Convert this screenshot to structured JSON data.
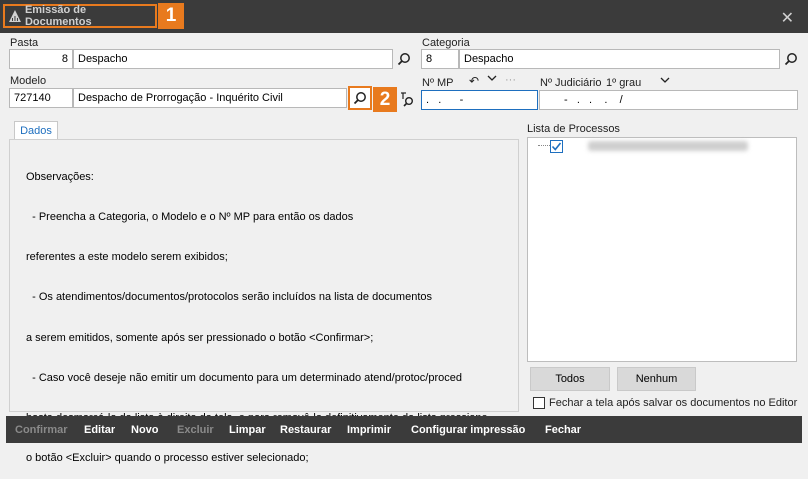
{
  "window": {
    "title": "Emissão de Documentos",
    "badge1": "1",
    "badge2": "2",
    "close_symbol": "✕"
  },
  "pasta": {
    "label": "Pasta",
    "code": "8",
    "name": "Despacho"
  },
  "categoria": {
    "label": "Categoria",
    "code": "8",
    "name": "Despacho"
  },
  "modelo": {
    "label": "Modelo",
    "code": "727140",
    "name": "Despacho de Prorrogação - Inquérito Civil"
  },
  "nmp": {
    "label": "Nº MP",
    "value": ".   .      -"
  },
  "judiciario": {
    "label": "Nº Judiciário",
    "grau": "1º grau",
    "value": "-   .   .    .    /"
  },
  "tabs": {
    "dados": "Dados"
  },
  "observacoes": {
    "lines": [
      "Observações:",
      "  - Preencha a Categoria, o Modelo e o Nº MP para então os dados",
      "referentes a este modelo serem exibidos;",
      "  - Os atendimentos/documentos/protocolos serão incluídos na lista de documentos",
      "a serem emitidos, somente após ser pressionado o botão <Confirmar>;",
      "  - Caso você deseje não emitir um documento para um determinado atend/protoc/proced",
      "basta desmarcá-lo da lista à direita da tela, e para removê-lo definitivamente da lista pressione",
      "o botão <Excluir> quando o processo estiver selecionado;"
    ]
  },
  "lista": {
    "label": "Lista de Processos",
    "items": [
      {
        "checked": true
      }
    ]
  },
  "buttons": {
    "todos": "Todos",
    "nenhum": "Nenhum"
  },
  "fechar_check": {
    "label": "Fechar a tela após salvar os documentos no Editor",
    "checked": false
  },
  "bottom": {
    "confirmar": "Confirmar",
    "editar": "Editar",
    "novo": "Novo",
    "excluir": "Excluir",
    "limpar": "Limpar",
    "restaurar": "Restaurar",
    "imprimir": "Imprimir",
    "configurar": "Configurar impressão",
    "fechar": "Fechar"
  },
  "colors": {
    "accent": "#e87a1e",
    "dark": "#3b3b3b",
    "focus": "#1e6fbf"
  }
}
